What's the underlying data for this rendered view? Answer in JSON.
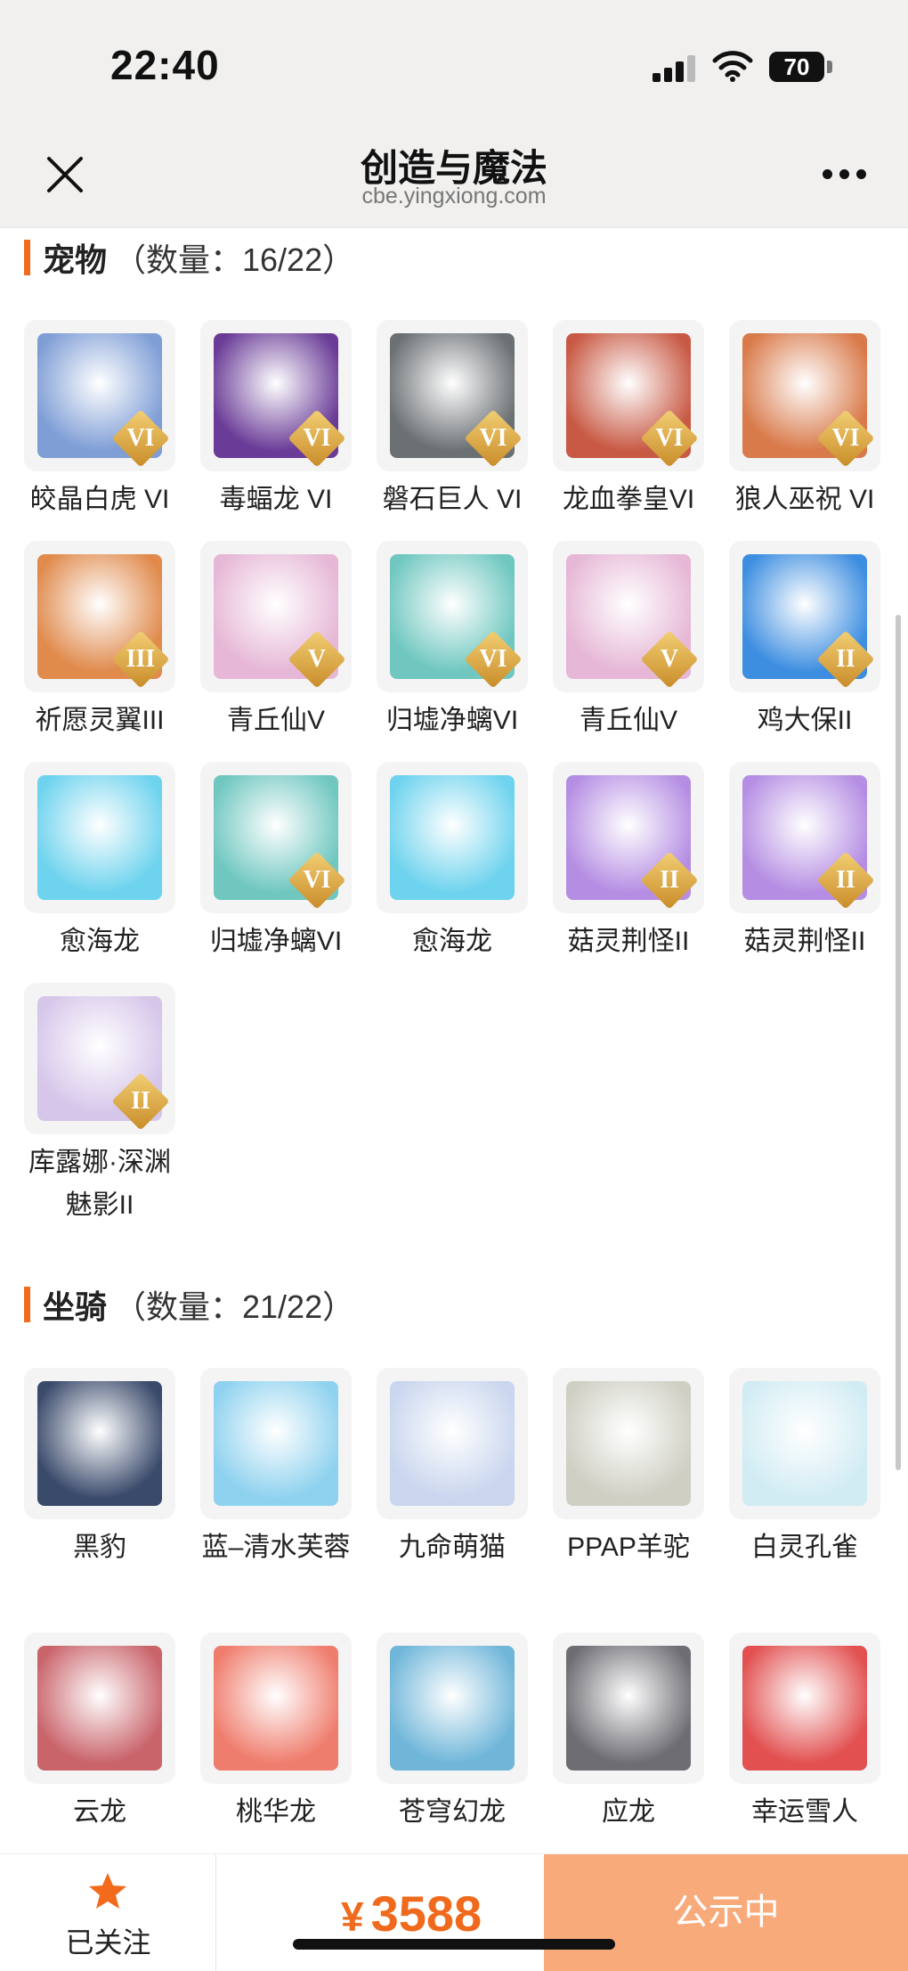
{
  "status_bar": {
    "time": "22:40",
    "battery": "70"
  },
  "nav": {
    "title": "创造与魔法",
    "subtitle": "cbe.yingxiong.com"
  },
  "pets_section": {
    "title": "宠物",
    "count": "（数量：16/22）",
    "items": [
      {
        "name": "皎晶白虎 VI",
        "badge": "VI",
        "color": "#7f9ed6"
      },
      {
        "name": "毒蝠龙 VI",
        "badge": "VI",
        "color": "#6a3c97"
      },
      {
        "name": "磐石巨人 VI",
        "badge": "VI",
        "color": "#6b7073"
      },
      {
        "name": "龙血拳皇VI",
        "badge": "VI",
        "color": "#c85a45"
      },
      {
        "name": "狼人巫祝 VI",
        "badge": "VI",
        "color": "#d97a4a"
      },
      {
        "name": "祈愿灵翼III",
        "badge": "III",
        "color": "#e08a4c"
      },
      {
        "name": "青丘仙V",
        "badge": "V",
        "color": "#e6b7d6"
      },
      {
        "name": "归墟净螭VI",
        "badge": "VI",
        "color": "#6fc7c0"
      },
      {
        "name": "青丘仙V",
        "badge": "V",
        "color": "#e6b7d6"
      },
      {
        "name": "鸡大保II",
        "badge": "II",
        "color": "#3d8ee0"
      },
      {
        "name": "愈海龙",
        "badge": "",
        "color": "#6ed3ee"
      },
      {
        "name": "归墟净螭VI",
        "badge": "VI",
        "color": "#6fc7c0"
      },
      {
        "name": "愈海龙",
        "badge": "",
        "color": "#6ed3ee"
      },
      {
        "name": "菇灵荆怪II",
        "badge": "II",
        "color": "#b58ee3"
      },
      {
        "name": "菇灵荆怪II",
        "badge": "II",
        "color": "#b58ee3"
      },
      {
        "name": "库露娜·深渊魅影II",
        "badge": "II",
        "color": "#d6c6ea"
      }
    ]
  },
  "mounts_section": {
    "title": "坐骑",
    "count": "（数量：21/22）",
    "items": [
      {
        "name": "黑豹",
        "badge": "",
        "color": "#3a4a6b"
      },
      {
        "name": "蓝–清水芙蓉",
        "badge": "",
        "color": "#8fd2ef"
      },
      {
        "name": "九命萌猫",
        "badge": "",
        "color": "#c9d6ee"
      },
      {
        "name": "PPAP羊驼",
        "badge": "",
        "color": "#cfcfc4"
      },
      {
        "name": "白灵孔雀",
        "badge": "",
        "color": "#d2ecf4"
      },
      {
        "name": "云龙",
        "badge": "",
        "color": "#c9646b"
      },
      {
        "name": "桃华龙",
        "badge": "",
        "color": "#ef7d6d"
      },
      {
        "name": "苍穹幻龙",
        "badge": "",
        "color": "#6fb6d9"
      },
      {
        "name": "应龙",
        "badge": "",
        "color": "#6d6d73"
      },
      {
        "name": "幸运雪人",
        "badge": "",
        "color": "#e25050"
      }
    ]
  },
  "bottom_bar": {
    "follow_label": "已关注",
    "currency": "¥",
    "price": "3588",
    "status_button": "公示中"
  },
  "colors": {
    "accent": "#f26b1d",
    "price": "#ef6a1c",
    "status_button_bg": "#f9aa7b"
  }
}
